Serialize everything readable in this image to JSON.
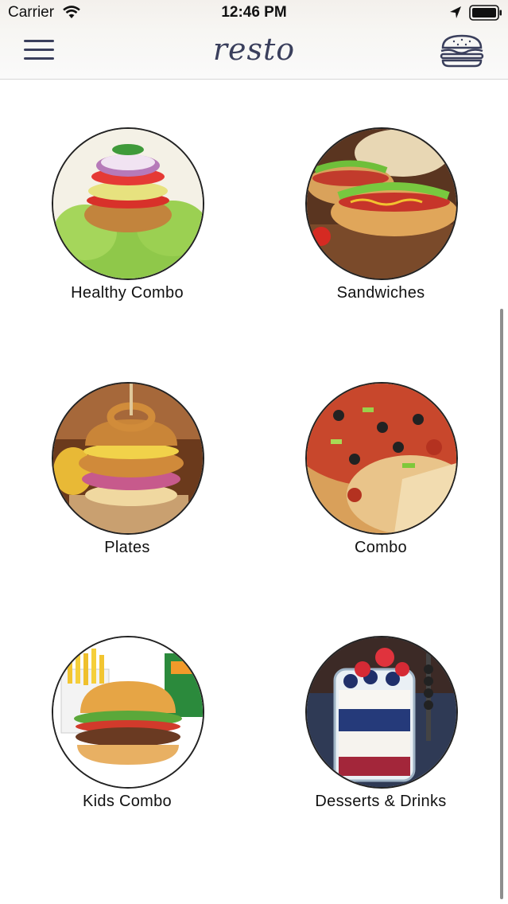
{
  "status_bar": {
    "carrier": "Carrier",
    "time": "12:46 PM"
  },
  "nav": {
    "title": "resto",
    "menu_icon": "hamburger-menu-icon",
    "cart_icon": "burger-icon"
  },
  "categories": [
    {
      "label": "Healthy Combo",
      "image": "healthy-combo-burger-photo"
    },
    {
      "label": "Sandwiches",
      "image": "hot-dog-sandwich-photo"
    },
    {
      "label": "Plates",
      "image": "fried-chicken-burger-photo"
    },
    {
      "label": "Combo",
      "image": "pizza-photo"
    },
    {
      "label": "Kids Combo",
      "image": "kids-burger-fries-photo"
    },
    {
      "label": "Desserts & Drinks",
      "image": "berry-parfait-jar-photo"
    }
  ]
}
